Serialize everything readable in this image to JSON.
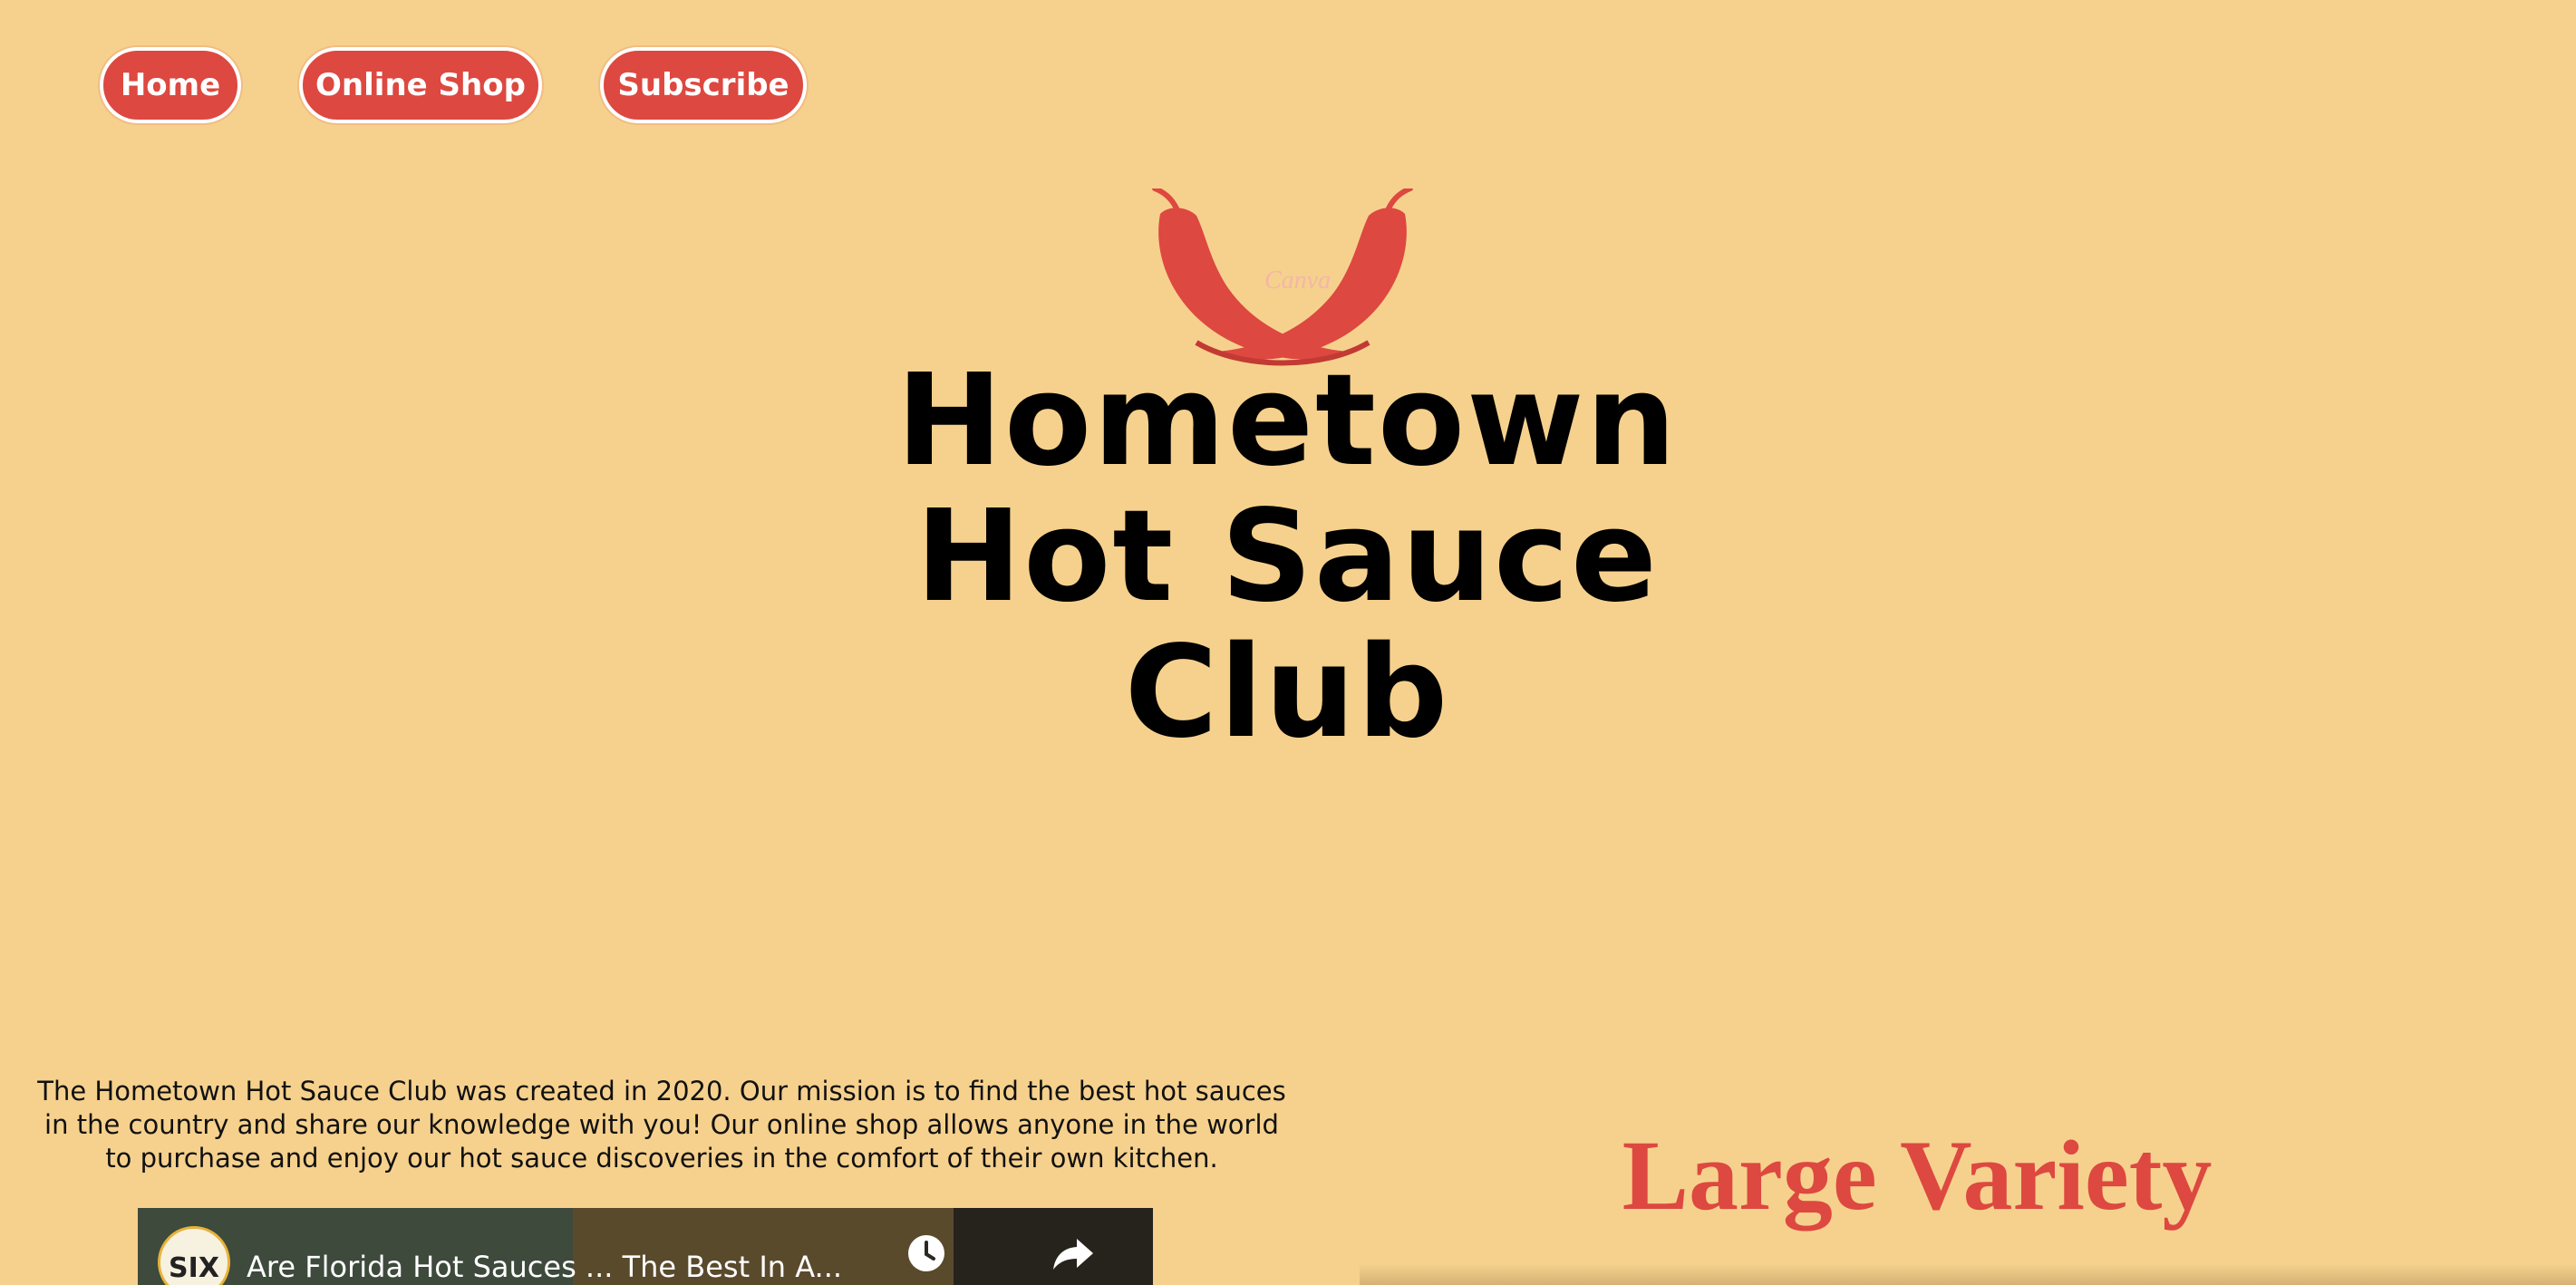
{
  "nav": {
    "home_label": "Home",
    "shop_label": "Online Shop",
    "subscribe_label": "Subscribe"
  },
  "logo": {
    "line1": "Hometown",
    "line2": "Hot Sauce",
    "line3": "Club",
    "watermark": "Canva",
    "icon": "chili-peppers-icon"
  },
  "mission": {
    "text": "The Hometown Hot Sauce Club was created in 2020. Our mission is to find the best hot sauces in the country and share our knowledge with you! Our online shop allows anyone in the world to purchase and enjoy our hot sauce discoveries in the comfort of their own kitchen."
  },
  "video": {
    "title": "Are Florida Hot Sauces ... The Best In A...",
    "channel_badge": "SIX",
    "icons": [
      "clock-icon",
      "share-icon"
    ]
  },
  "section": {
    "heading": "Large Variety"
  },
  "colors": {
    "background": "#f6d18d",
    "accent": "#dd4840",
    "text": "#000000"
  }
}
